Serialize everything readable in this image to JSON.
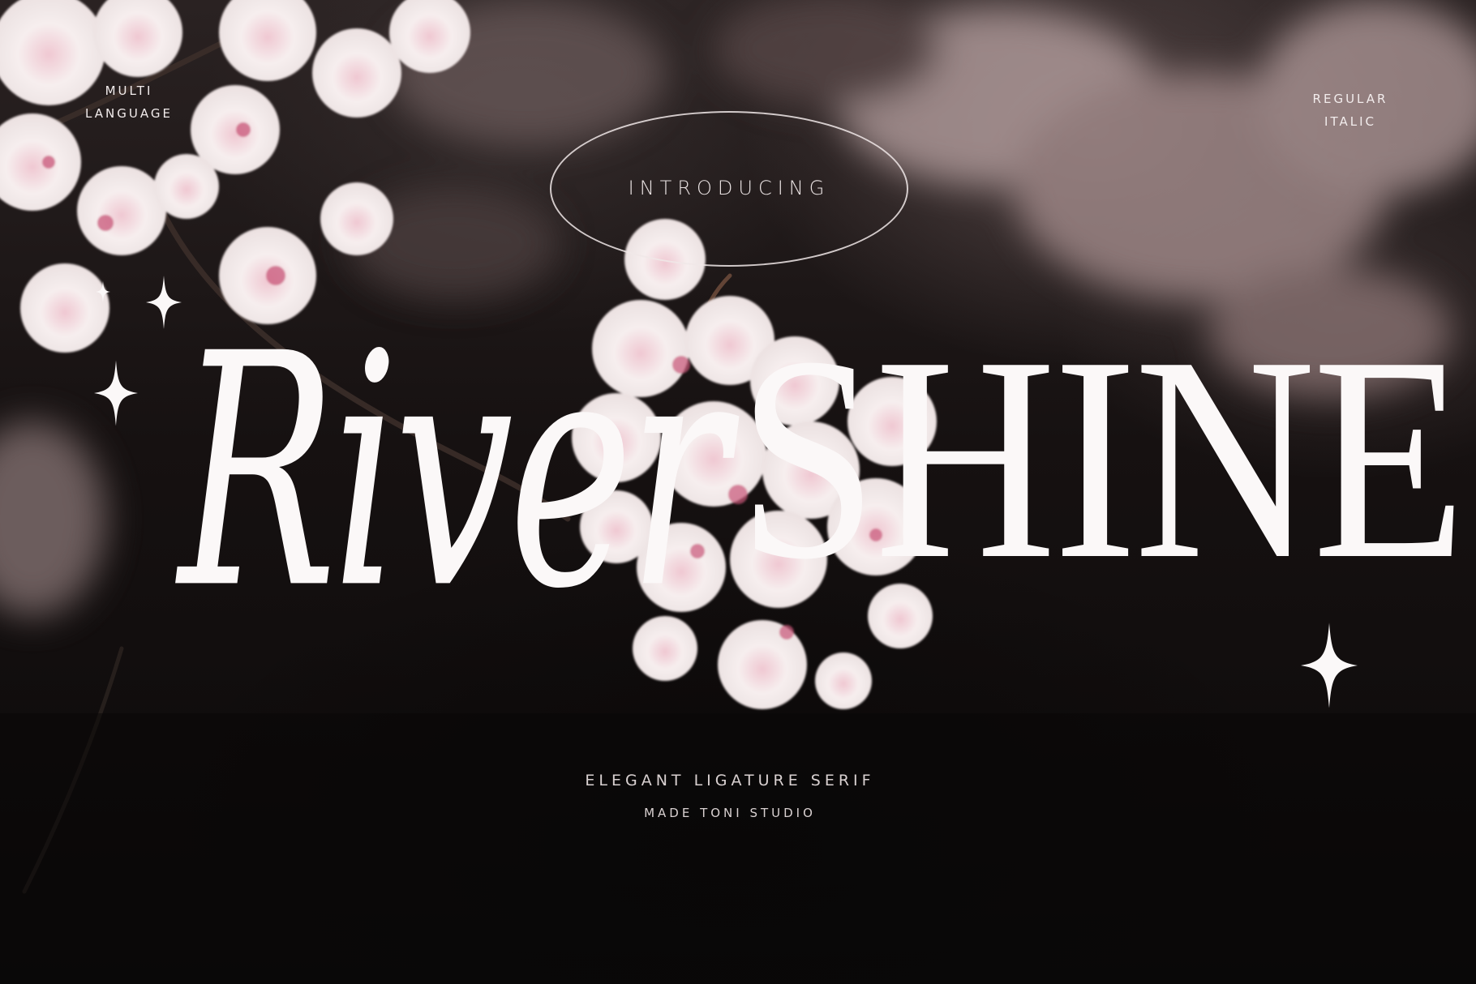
{
  "corner_left": {
    "line1": "MULTI",
    "line2": "LANGUAGE"
  },
  "corner_right": {
    "line1": "REGULAR",
    "line2": "ITALIC"
  },
  "intro": {
    "label": "INTRODUCING"
  },
  "title": {
    "italic_part": "River",
    "upright_part": "SHINE"
  },
  "subtitle": "ELEGANT LIGATURE SERIF",
  "credit": "MADE TONI STUDIO",
  "icons": {
    "sparkles": [
      "sparkle-icon",
      "sparkle-icon",
      "sparkle-icon",
      "sparkle-icon"
    ]
  },
  "colors": {
    "text": "#fbf8f8",
    "background": "#0c0a0a",
    "blossom": "#f3e6e6",
    "blossom_center": "#c9577a"
  }
}
